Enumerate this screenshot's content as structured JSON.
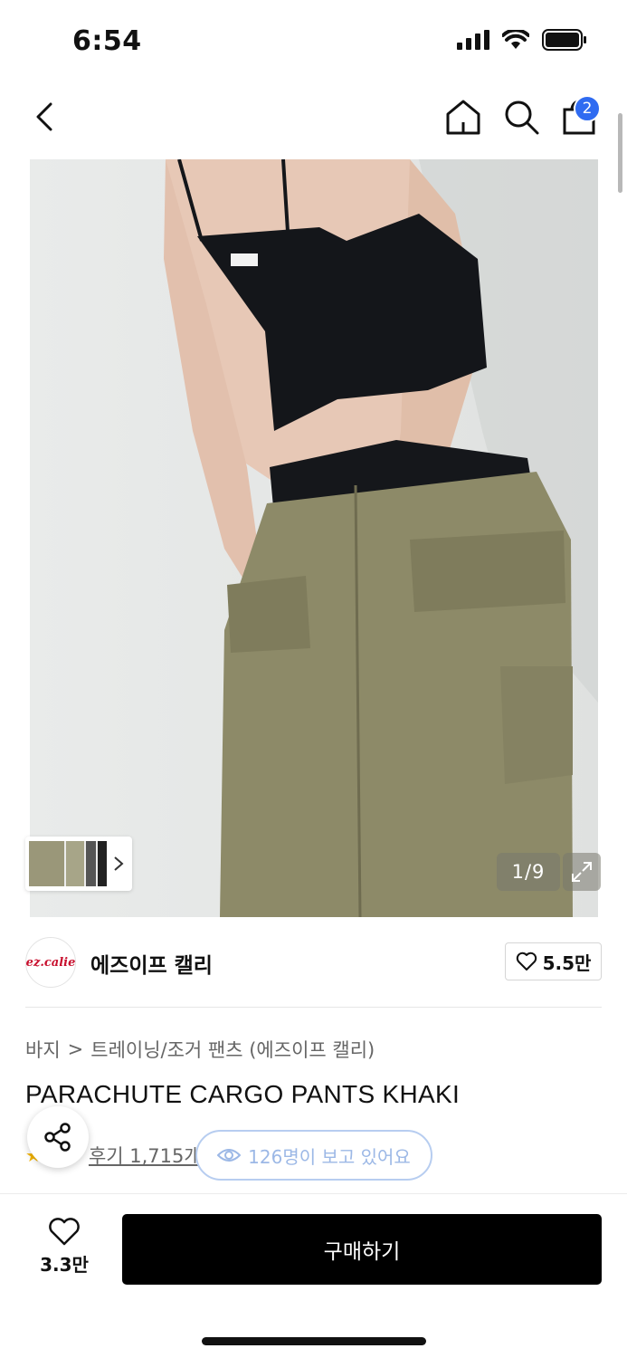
{
  "status_bar": {
    "time": "6:54"
  },
  "nav": {
    "cart_badge": "2",
    "icons": [
      "chevron-left-icon",
      "home-icon",
      "search-icon",
      "shopping-bag-icon"
    ]
  },
  "gallery": {
    "counter": "1/9"
  },
  "brand": {
    "logo_text": "ez.calie",
    "name": "에즈이프 캘리",
    "like_count": "5.5만"
  },
  "breadcrumb": {
    "category": "바지",
    "separator": ">",
    "subcategory": "트레이닝/조거 팬츠 (에즈이프 캘리)"
  },
  "product": {
    "title": "PARACHUTE CARGO PANTS KHAKI"
  },
  "reviews": {
    "link": "후기 1,715개",
    "viewers": "126명이 보고 있어요"
  },
  "bottom_bar": {
    "like_count": "3.3만",
    "buy_label": "구매하기"
  },
  "colors": {
    "accent": "#2f6bf1",
    "buy_button": "#000000",
    "viewers_pill": "#9cb8e6",
    "star": "#f4b400"
  }
}
